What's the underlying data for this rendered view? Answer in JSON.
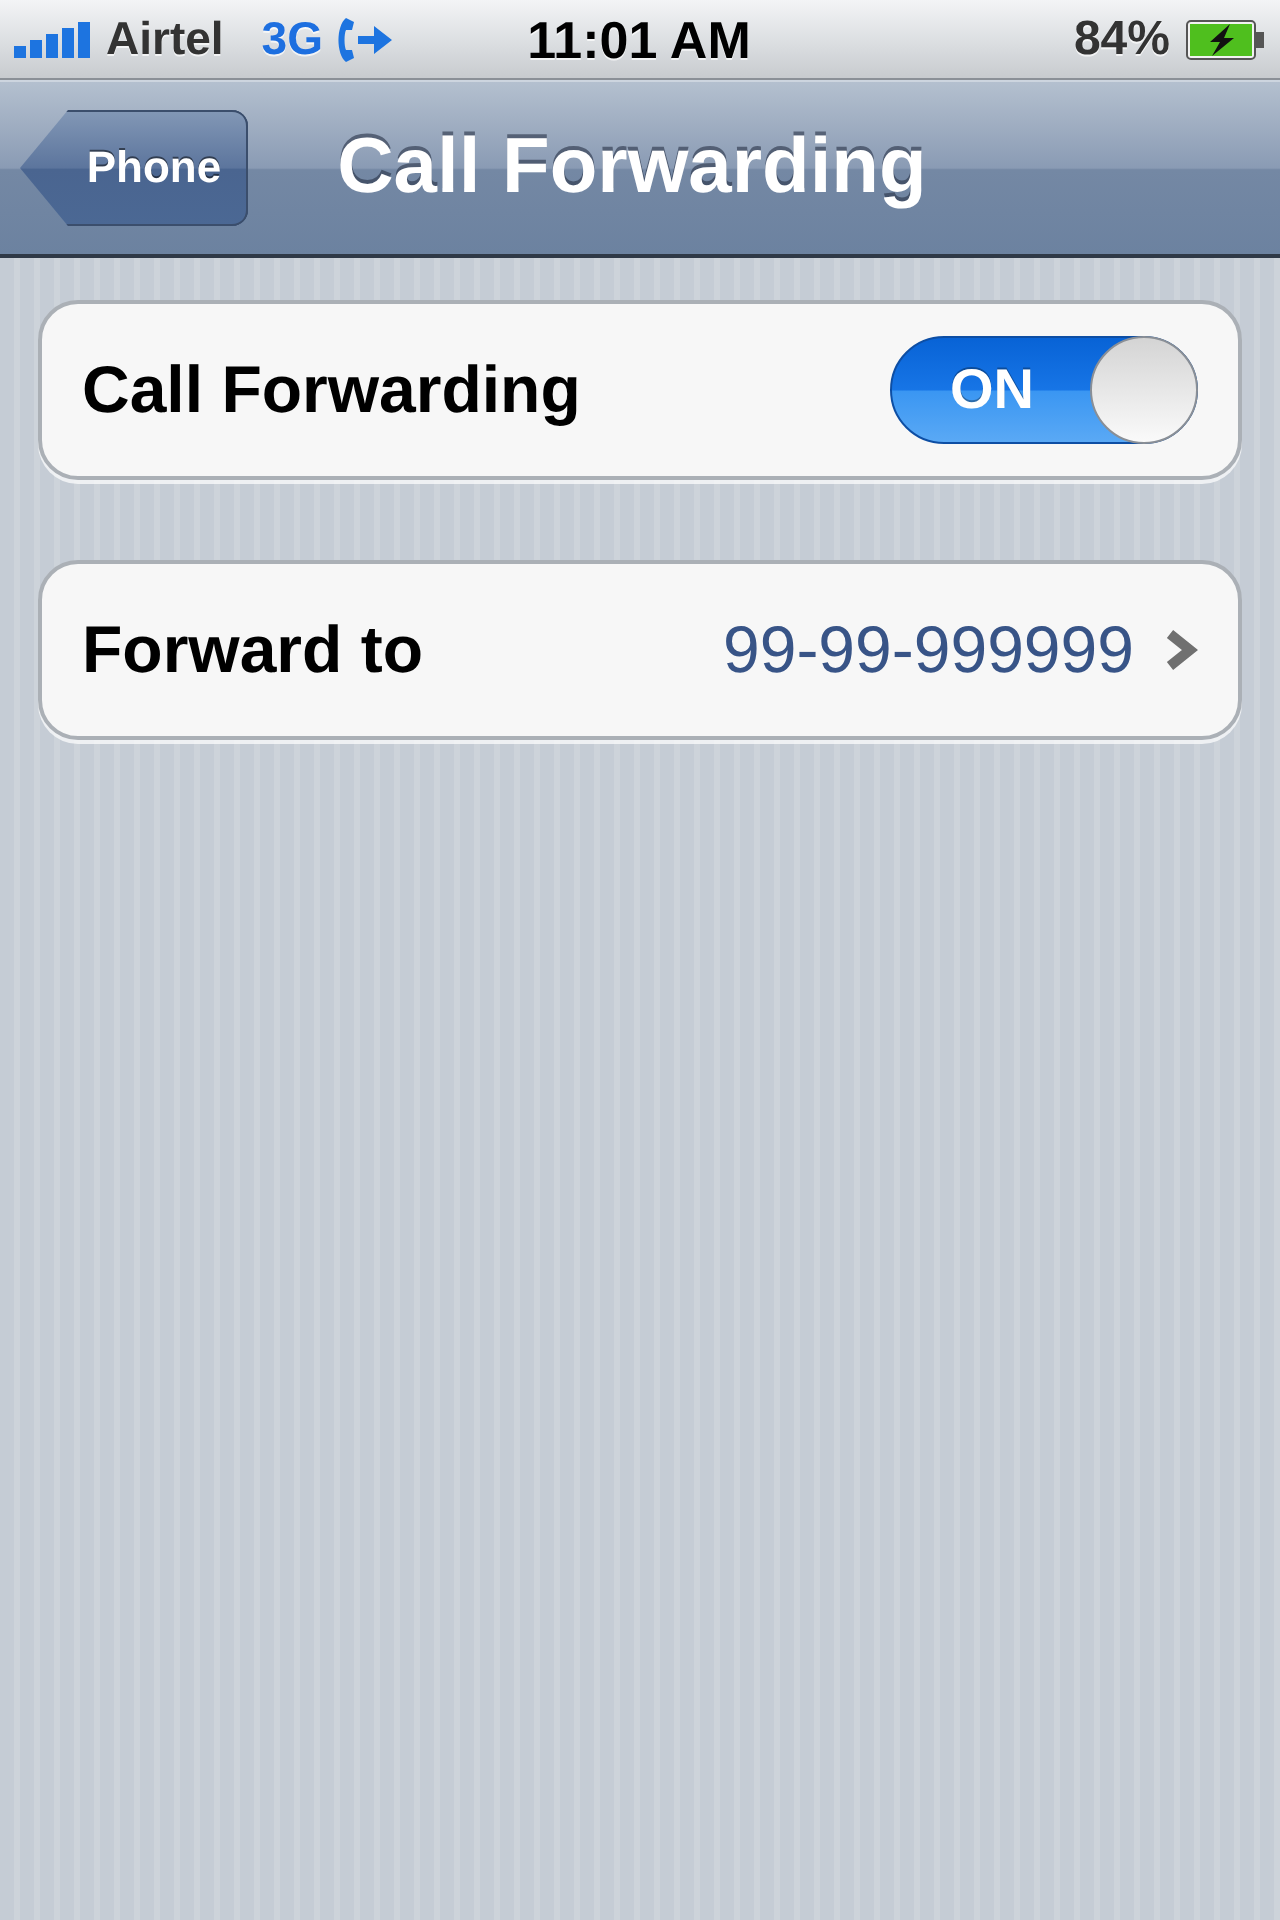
{
  "status_bar": {
    "carrier": "Airtel",
    "network": "3G",
    "time": "11:01 AM",
    "battery": "84%",
    "charging": true
  },
  "nav_bar": {
    "back": "Phone",
    "title": "Call Forwarding"
  },
  "groups": [
    {
      "rows": [
        {
          "kind": "toggle",
          "label": "Call Forwarding",
          "on": true,
          "switch_text": "ON"
        }
      ]
    },
    {
      "rows": [
        {
          "kind": "disclosure",
          "label": "Forward to",
          "value": "99-99-999999"
        }
      ]
    }
  ]
}
